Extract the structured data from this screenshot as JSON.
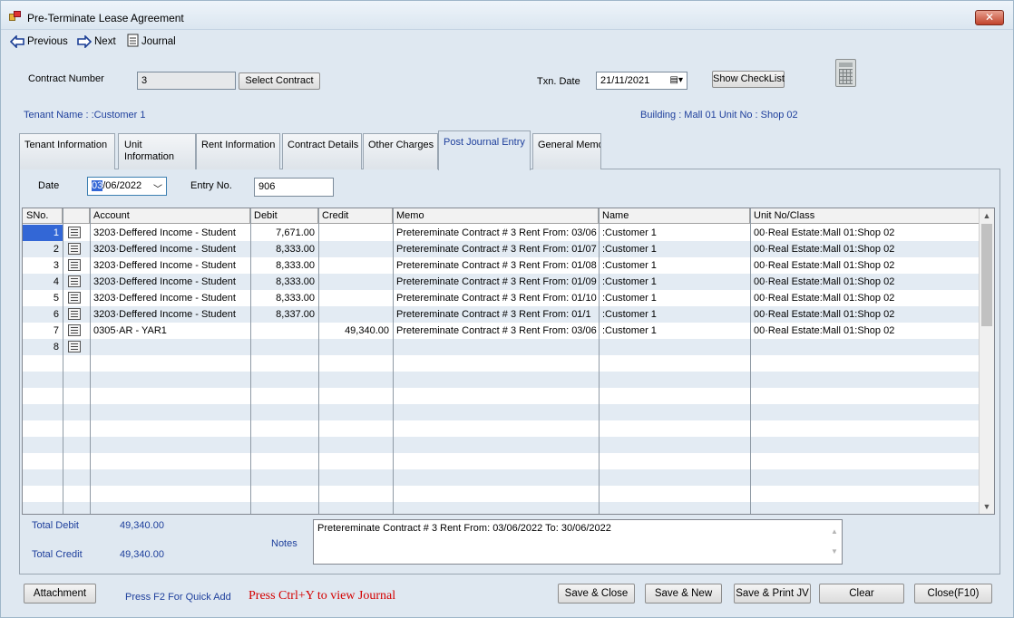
{
  "window": {
    "title": "Pre-Terminate Lease Agreement",
    "close_glyph": "✕"
  },
  "toolbar": {
    "previous": "Previous",
    "next": "Next",
    "journal": "Journal"
  },
  "header": {
    "contract_number_label": "Contract Number",
    "contract_number_value": "3",
    "select_contract": "Select Contract",
    "txn_date_label": "Txn. Date",
    "txn_date_value": "21/11/2021",
    "show_checklist": "Show CheckList",
    "tenant_name": "Tenant Name : :Customer 1",
    "building_unit": "Building : Mall 01  Unit No : Shop 02"
  },
  "tabs": [
    {
      "label": "Tenant Information"
    },
    {
      "label": "Unit Information"
    },
    {
      "label": "Rent Information"
    },
    {
      "label": "Contract Details"
    },
    {
      "label": "Other Charges"
    },
    {
      "label": "Post Journal Entry"
    },
    {
      "label": "General Memo"
    }
  ],
  "entry": {
    "date_label": "Date",
    "date_sel": "03",
    "date_rest": "/06/2022",
    "entry_no_label": "Entry No.",
    "entry_no_value": "906"
  },
  "grid": {
    "columns": [
      "SNo.",
      "",
      "Account",
      "Debit",
      "Credit",
      "Memo",
      "Name",
      "Unit No/Class"
    ],
    "rows": [
      {
        "sno": "1",
        "account": "3203·Deffered Income - Student",
        "debit": "7,671.00",
        "credit": "",
        "memo": "Pretereminate Contract # 3 Rent From: 03/06",
        "name": ":Customer 1",
        "unit": "00·Real Estate:Mall 01:Shop 02"
      },
      {
        "sno": "2",
        "account": "3203·Deffered Income - Student",
        "debit": "8,333.00",
        "credit": "",
        "memo": "Pretereminate Contract # 3 Rent From: 01/07",
        "name": ":Customer 1",
        "unit": "00·Real Estate:Mall 01:Shop 02"
      },
      {
        "sno": "3",
        "account": "3203·Deffered Income - Student",
        "debit": "8,333.00",
        "credit": "",
        "memo": "Pretereminate Contract # 3 Rent From: 01/08",
        "name": ":Customer 1",
        "unit": "00·Real Estate:Mall 01:Shop 02"
      },
      {
        "sno": "4",
        "account": "3203·Deffered Income - Student",
        "debit": "8,333.00",
        "credit": "",
        "memo": "Pretereminate Contract # 3 Rent From: 01/09",
        "name": ":Customer 1",
        "unit": "00·Real Estate:Mall 01:Shop 02"
      },
      {
        "sno": "5",
        "account": "3203·Deffered Income - Student",
        "debit": "8,333.00",
        "credit": "",
        "memo": "Pretereminate Contract # 3 Rent From: 01/10",
        "name": ":Customer 1",
        "unit": "00·Real Estate:Mall 01:Shop 02"
      },
      {
        "sno": "6",
        "account": "3203·Deffered Income - Student",
        "debit": "8,337.00",
        "credit": "",
        "memo": "Pretereminate Contract # 3 Rent From: 01/1",
        "name": ":Customer 1",
        "unit": "00·Real Estate:Mall 01:Shop 02"
      },
      {
        "sno": "7",
        "account": "0305·AR - YAR1",
        "debit": "",
        "credit": "49,340.00",
        "memo": "Pretereminate Contract # 3 Rent From: 03/06",
        "name": ":Customer 1",
        "unit": "00·Real Estate:Mall 01:Shop 02"
      },
      {
        "sno": "8",
        "account": "",
        "debit": "",
        "credit": "",
        "memo": "",
        "name": "",
        "unit": ""
      }
    ]
  },
  "totals": {
    "total_debit_label": "Total Debit",
    "total_debit": "49,340.00",
    "total_credit_label": "Total Credit",
    "total_credit": "49,340.00",
    "notes_label": "Notes",
    "notes_value": "Pretereminate Contract # 3 Rent From: 03/06/2022 To: 30/06/2022"
  },
  "footer": {
    "attachment": "Attachment",
    "quick_add_hint": "Press F2 For Quick Add",
    "journal_hint": "Press Ctrl+Y to view Journal",
    "save_close": "Save & Close",
    "save_new": "Save & New",
    "save_print": "Save & Print JV",
    "clear": "Clear",
    "close": "Close(F10)"
  },
  "icons": [
    "app-icon",
    "arrow-left-icon",
    "arrow-right-icon",
    "journal-icon",
    "calendar-icon",
    "calculator-icon",
    "row-detail-icon",
    "scroll-up-icon",
    "scroll-down-icon"
  ]
}
